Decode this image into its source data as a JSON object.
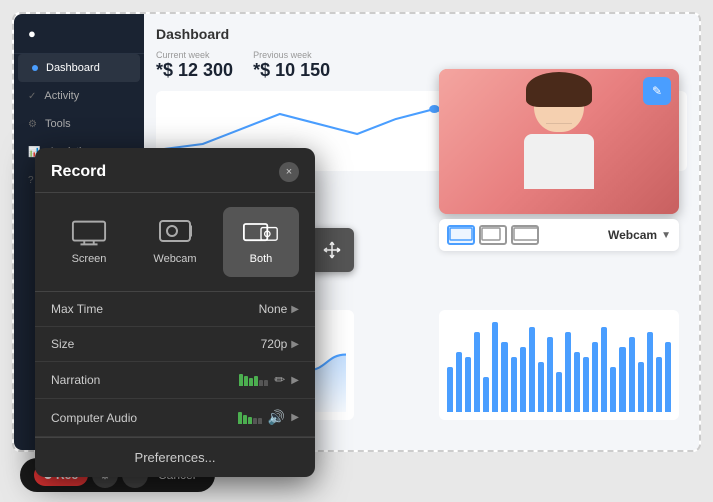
{
  "app": {
    "title": "Dashboard"
  },
  "dashboard": {
    "title": "Dashboard",
    "current_week_label": "Current week",
    "current_week_value": "*$ 12 300",
    "previous_week_label": "Previous week",
    "previous_week_value": "*$ 10 150"
  },
  "sidebar": {
    "items": [
      {
        "label": "Dashboard",
        "active": true
      },
      {
        "label": "Activity",
        "active": false
      },
      {
        "label": "Tools",
        "active": false
      },
      {
        "label": "Analytics",
        "active": false
      },
      {
        "label": "Help",
        "active": false
      }
    ]
  },
  "record_modal": {
    "title": "Record",
    "close_label": "×",
    "sources": [
      {
        "label": "Screen",
        "id": "screen"
      },
      {
        "label": "Webcam",
        "id": "webcam"
      },
      {
        "label": "Both",
        "id": "both",
        "active": true
      }
    ],
    "settings": [
      {
        "label": "Max Time",
        "value": "None",
        "id": "max-time"
      },
      {
        "label": "Size",
        "value": "720p",
        "id": "size"
      },
      {
        "label": "Narration",
        "value": "",
        "id": "narration"
      },
      {
        "label": "Computer Audio",
        "value": "",
        "id": "computer-audio"
      }
    ],
    "preferences_label": "Preferences..."
  },
  "webcam": {
    "label": "Webcam",
    "edit_icon": "✎"
  },
  "bottom_toolbar": {
    "rec_label": "Rec",
    "cancel_label": "Cancel"
  },
  "bars": [
    45,
    60,
    55,
    80,
    35,
    90,
    70,
    55,
    65,
    85,
    50,
    75,
    40,
    80,
    60,
    55,
    70,
    85,
    45,
    65,
    75,
    50,
    80,
    55,
    70
  ]
}
